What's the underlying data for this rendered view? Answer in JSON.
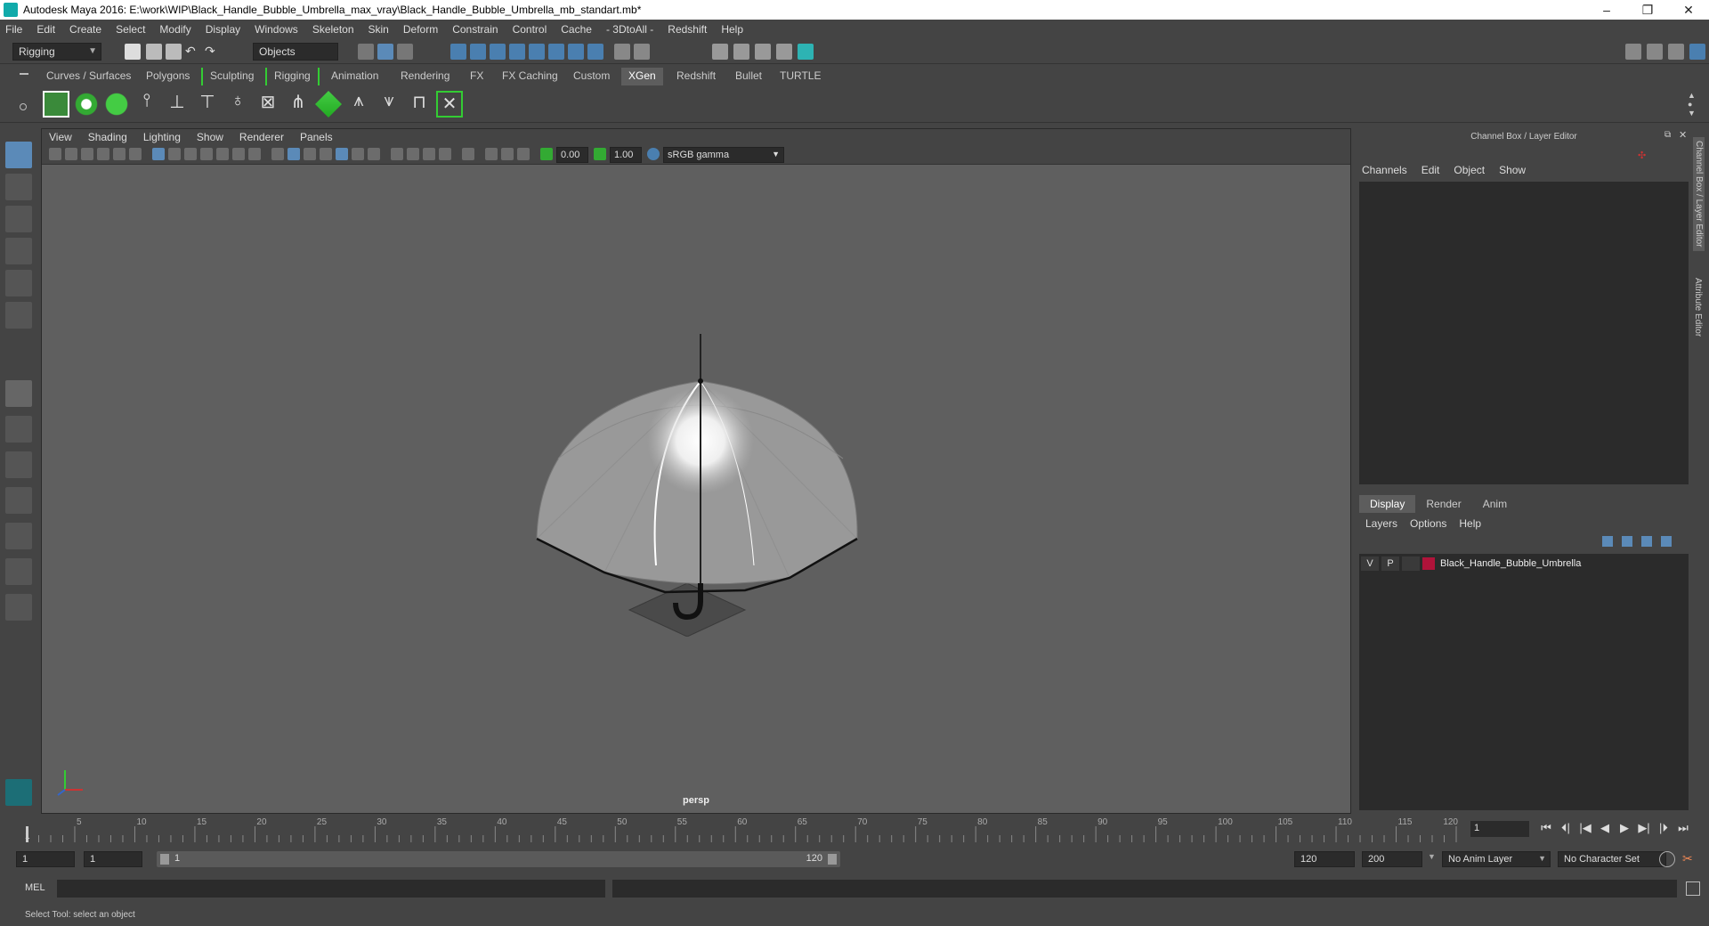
{
  "window": {
    "title": "Autodesk Maya 2016: E:\\work\\WIP\\Black_Handle_Bubble_Umbrella_max_vray\\Black_Handle_Bubble_Umbrella_mb_standart.mb*",
    "controls": [
      "–",
      "❐",
      "✕"
    ]
  },
  "menubar": [
    "File",
    "Edit",
    "Create",
    "Select",
    "Modify",
    "Display",
    "Windows",
    "Skeleton",
    "Skin",
    "Deform",
    "Constrain",
    "Control",
    "Cache",
    "- 3DtoAll -",
    "Redshift",
    "Help"
  ],
  "statusline": {
    "mode": "Rigging",
    "selection_mode": "Objects"
  },
  "shelf_tabs": [
    {
      "label": "Curves / Surfaces",
      "active": false
    },
    {
      "label": "Polygons",
      "active": false
    },
    {
      "label": "Sculpting",
      "active": false
    },
    {
      "label": "Rigging",
      "active": false
    },
    {
      "label": "Animation",
      "active": false
    },
    {
      "label": "Rendering",
      "active": false
    },
    {
      "label": "FX",
      "active": false
    },
    {
      "label": "FX Caching",
      "active": false
    },
    {
      "label": "Custom",
      "active": false
    },
    {
      "label": "XGen",
      "active": true
    },
    {
      "label": "Redshift",
      "active": false
    },
    {
      "label": "Bullet",
      "active": false
    },
    {
      "label": "TURTLE",
      "active": false
    }
  ],
  "viewport": {
    "menu": [
      "View",
      "Shading",
      "Lighting",
      "Show",
      "Renderer",
      "Panels"
    ],
    "exposure": "0.00",
    "gamma": "1.00",
    "color_space": "sRGB gamma",
    "camera_label": "persp"
  },
  "right_panel": {
    "title": "Channel Box / Layer Editor",
    "menu": [
      "Channels",
      "Edit",
      "Object",
      "Show"
    ],
    "layer_tabs": [
      {
        "label": "Display",
        "active": true
      },
      {
        "label": "Render",
        "active": false
      },
      {
        "label": "Anim",
        "active": false
      }
    ],
    "layer_menu": [
      "Layers",
      "Options",
      "Help"
    ],
    "layers": [
      {
        "v": "V",
        "p": "P",
        "color": "#b0133a",
        "name": "Black_Handle_Bubble_Umbrella"
      }
    ],
    "side_tabs": [
      "Channel Box / Layer Editor",
      "Attribute Editor"
    ]
  },
  "timeline": {
    "ticks": [
      "5",
      "10",
      "15",
      "20",
      "25",
      "30",
      "35",
      "40",
      "45",
      "50",
      "55",
      "60",
      "65",
      "70",
      "75",
      "80",
      "85",
      "90",
      "95",
      "100",
      "105",
      "110",
      "115",
      "120"
    ],
    "first_tick": "1",
    "current_frame": "1",
    "playback": [
      "⏮",
      "⏴|",
      "|◀",
      "◀",
      "▶",
      "▶|",
      "|⏵",
      "⏭"
    ]
  },
  "range": {
    "start": "1",
    "playback_start": "1",
    "slider_start": "1",
    "slider_end": "120",
    "playback_end": "120",
    "end": "200",
    "anim_layer": "No Anim Layer",
    "character_set": "No Character Set"
  },
  "command_line": {
    "label": "MEL"
  },
  "help_line": "Select Tool: select an object"
}
